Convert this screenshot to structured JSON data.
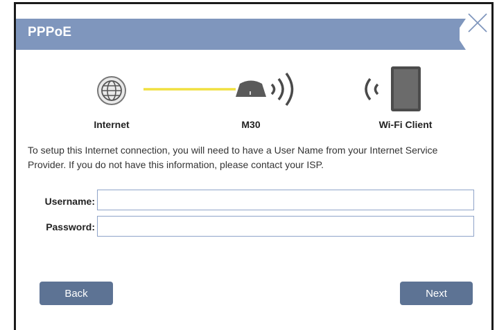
{
  "dialog": {
    "title": "PPPoE",
    "close_icon": "close-icon"
  },
  "diagram": {
    "internet_label": "Internet",
    "device_label": "M30",
    "client_label": "Wi-Fi Client",
    "link_color": "#f0e040"
  },
  "intro_text": "To setup this Internet connection, you will need to have a User Name from your Internet Service Provider. If you do not have this information, please contact your ISP.",
  "form": {
    "username_label": "Username:",
    "username_value": "",
    "password_label": "Password:",
    "password_value": ""
  },
  "buttons": {
    "back_label": "Back",
    "next_label": "Next"
  },
  "colors": {
    "header": "#7f96bd",
    "button": "#5d7394",
    "input_border": "#8ea3c8"
  }
}
